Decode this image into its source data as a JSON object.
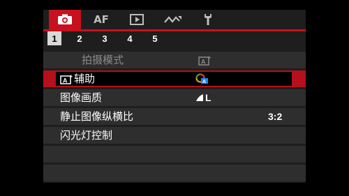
{
  "tabs": [
    {
      "id": "shooting",
      "icon": "camera-icon",
      "active": true
    },
    {
      "id": "af",
      "label": "AF",
      "active": false
    },
    {
      "id": "playback",
      "icon": "playback-icon",
      "active": false
    },
    {
      "id": "wireless",
      "icon": "wireless-icon",
      "active": false
    },
    {
      "id": "setup",
      "icon": "wrench-icon",
      "active": false
    }
  ],
  "pages": [
    "1",
    "2",
    "3",
    "4",
    "5"
  ],
  "active_page": "1",
  "menu": {
    "shooting_mode": {
      "label": "拍摄模式",
      "value_icon": "auto-plus-icon",
      "disabled": true
    },
    "assist": {
      "label": "辅助",
      "label_icon": "auto-plus-icon",
      "value_icon": "creative-assist-icon",
      "selected": true
    },
    "image_quality": {
      "label": "图像画质",
      "value_icon": "large-fine-icon",
      "value_text": "L"
    },
    "aspect_ratio": {
      "label": "静止图像纵横比",
      "value": "3:2"
    },
    "flash_control": {
      "label": "闪光灯控制"
    }
  },
  "colors": {
    "accent": "#c8101e",
    "row": "#2e2e2e",
    "background": "#1e1e1e"
  }
}
